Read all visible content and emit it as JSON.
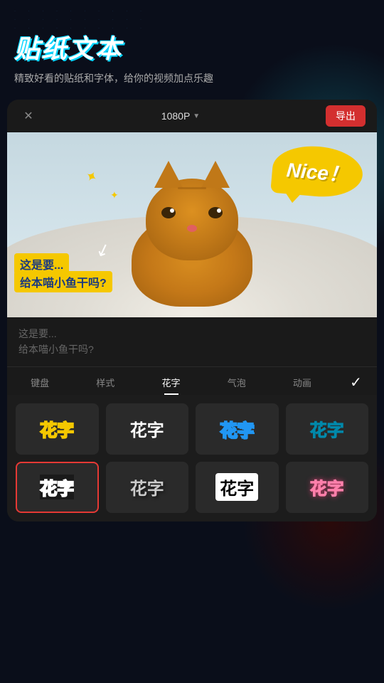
{
  "page": {
    "background_color": "#0a0e1a"
  },
  "promo": {
    "title": "贴纸文本",
    "subtitle": "精致好看的贴纸和字体，给你的视频加点乐趣"
  },
  "header": {
    "resolution": "1080P",
    "export_label": "导出",
    "close_icon": "×"
  },
  "video": {
    "sticker_nice": "Nice！",
    "text_line1": "这是要...",
    "text_line2": "给本喵小鱼干吗?"
  },
  "text_inputs": {
    "line1": "这是要...",
    "line2": "给本喵小鱼干吗?"
  },
  "tabs": [
    {
      "id": "keyboard",
      "label": "键盘",
      "active": false
    },
    {
      "id": "style",
      "label": "样式",
      "active": false
    },
    {
      "id": "huazi",
      "label": "花字",
      "active": true
    },
    {
      "id": "bubble",
      "label": "气泡",
      "active": false
    },
    {
      "id": "animation",
      "label": "动画",
      "active": false
    }
  ],
  "font_styles": [
    {
      "id": 1,
      "text": "花字",
      "style_class": "style-1",
      "selected": false
    },
    {
      "id": 2,
      "text": "花字",
      "style_class": "style-2",
      "selected": false
    },
    {
      "id": 3,
      "text": "花字",
      "style_class": "style-3",
      "selected": false
    },
    {
      "id": 4,
      "text": "花字",
      "style_class": "style-4",
      "selected": false
    },
    {
      "id": 5,
      "text": "花字",
      "style_class": "style-5",
      "selected": true
    },
    {
      "id": 6,
      "text": "花字",
      "style_class": "style-6",
      "selected": false
    },
    {
      "id": 7,
      "text": "花字",
      "style_class": "style-7",
      "selected": false
    },
    {
      "id": 8,
      "text": "花字",
      "style_class": "style-8",
      "selected": false
    }
  ],
  "icons": {
    "close": "✕",
    "chevron_down": "▼",
    "check": "✓",
    "sparkle": "✦"
  }
}
